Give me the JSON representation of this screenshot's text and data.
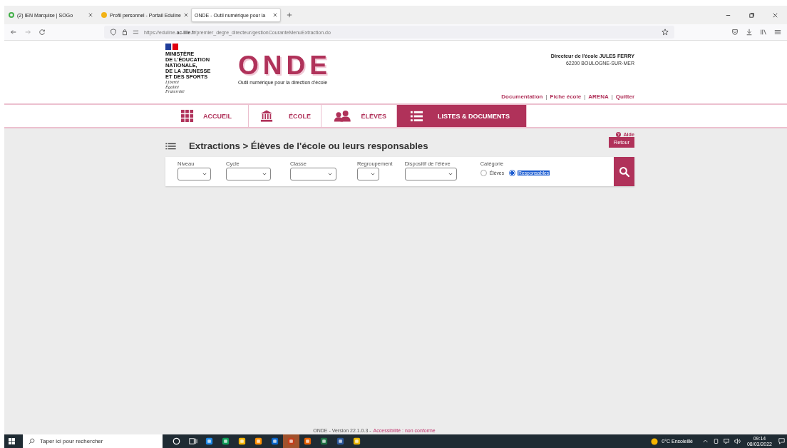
{
  "browser": {
    "tabs": [
      {
        "title": "(2) IEN Marquise | SOGo",
        "selected": false
      },
      {
        "title": "Profil personnel - Portail Eduline",
        "selected": false
      },
      {
        "title": "ONDE - Outil numérique pour la",
        "selected": true
      }
    ],
    "url": "https://eduline.**ac-lille.fr**/premier_degre_directeur/gestionCouranteMenuExtraction.do"
  },
  "header": {
    "ministry": [
      "MINISTÈRE",
      "DE L'ÉDUCATION",
      "NATIONALE,",
      "DE LA JEUNESSE",
      "ET DES SPORTS"
    ],
    "motto": [
      "Liberté",
      "Égalité",
      "Fraternité"
    ],
    "logo": "ONDE",
    "subtitle": "Outil numérique pour la direction d'école",
    "user": "Directeur de l'école JULES FERRY",
    "address": "62200 BOULOGNE-SUR-MER",
    "links": [
      "Documentation",
      "Fiche école",
      "ARENA",
      "Quitter"
    ],
    "separator": "|"
  },
  "nav": [
    {
      "label": "ACCUEIL",
      "kind": "grid",
      "selected": false
    },
    {
      "label": "ÉCOLE",
      "kind": "building",
      "selected": false
    },
    {
      "label": "ÉLÈVES",
      "kind": "people",
      "selected": false
    },
    {
      "label": "LISTES & DOCUMENTS",
      "kind": "list",
      "selected": true
    }
  ],
  "help": "Aide",
  "title": "Extractions > Élèves de l'école ou leurs responsables",
  "back_button": "Retour",
  "filters": [
    {
      "label": "Niveau"
    },
    {
      "label": "Cycle"
    },
    {
      "label": "Classe"
    },
    {
      "label": "Regroupement"
    },
    {
      "label": "Dispositif de l'élève"
    }
  ],
  "category": {
    "label": "Catégorie",
    "options": [
      {
        "label": "Élèves",
        "selected": false,
        "highlighted": false
      },
      {
        "label": "Responsables",
        "selected": true,
        "highlighted": true
      }
    ]
  },
  "footer": {
    "version": "ONDE - Version 22.1.0.3 -",
    "link": "Accessibilité : non conforme"
  },
  "taskbar": {
    "search_placeholder": "Taper ici pour rechercher",
    "weather": "0°C Ensoleillé",
    "time": "09:14",
    "date": "08/03/2022"
  }
}
